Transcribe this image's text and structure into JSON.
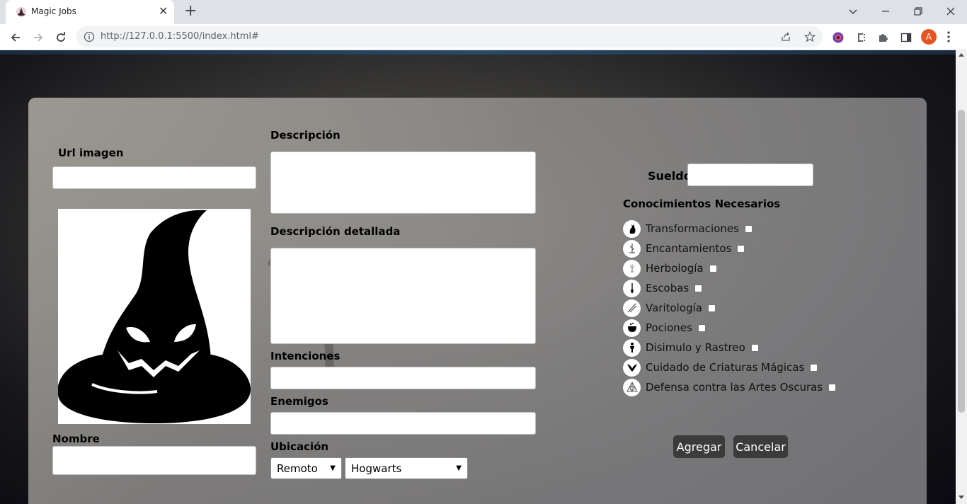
{
  "browser": {
    "tab_title": "Magic Jobs",
    "url": "http://127.0.0.1:5500/index.html#",
    "profile_initial": "A"
  },
  "form": {
    "url_imagen_label": "Url imagen",
    "nombre_label": "Nombre",
    "descripcion_label": "Descripción",
    "descripcion_detallada_label": "Descripción detallada",
    "intenciones_label": "Intenciones",
    "enemigos_label": "Enemigos",
    "ubicacion_label": "Ubicación",
    "ubicacion_modo": "Remoto",
    "ubicacion_lugar": "Hogwarts",
    "sueldo_label": "Sueldo",
    "conocimientos_label": "Conocimientos Necesarios",
    "skills": [
      {
        "name": "Transformaciones",
        "icon": "cat-icon"
      },
      {
        "name": "Encantamientos",
        "icon": "feather-icon"
      },
      {
        "name": "Herbología",
        "icon": "mandrake-icon"
      },
      {
        "name": "Escobas",
        "icon": "broom-icon"
      },
      {
        "name": "Varitología",
        "icon": "wand-icon"
      },
      {
        "name": "Pociones",
        "icon": "cauldron-icon"
      },
      {
        "name": "Disimulo y Rastreo",
        "icon": "cloaked-figure-icon"
      },
      {
        "name": "Cuidado de Criaturas Mágicas",
        "icon": "hippogriff-icon"
      },
      {
        "name": "Defensa contra las Artes Oscuras",
        "icon": "deathly-hallows-icon"
      }
    ],
    "agregar_label": "Agregar",
    "cancelar_label": "Cancelar"
  },
  "colors": {
    "button_bg": "#3b3b3b",
    "profile_bg": "#e8541f"
  }
}
